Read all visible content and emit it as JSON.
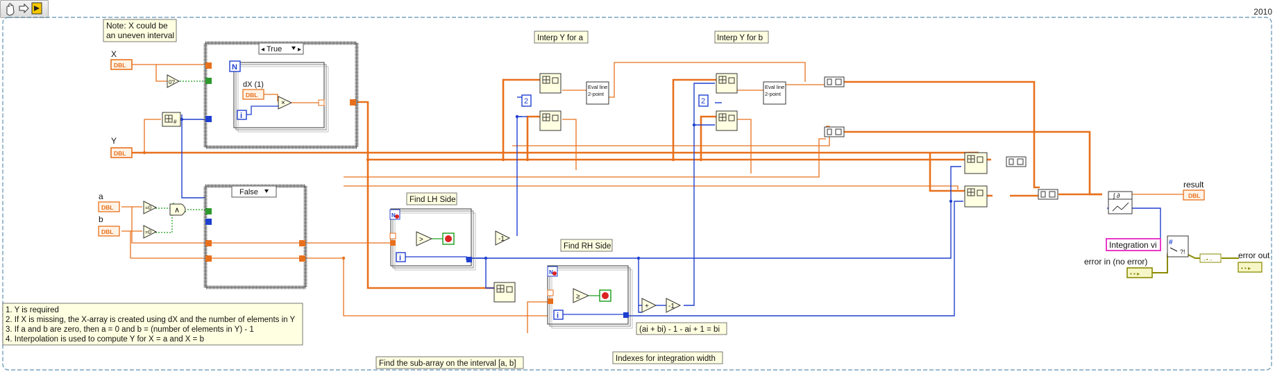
{
  "toolbar": {
    "tools": [
      "hand-tool-icon",
      "run-arrow-icon",
      "highlight-execution-icon"
    ]
  },
  "version_label": "2010",
  "colors": {
    "orange_wire": "#e8701c",
    "blue_wire": "#1f3fcf",
    "green_wire": "#169a16",
    "frame_dash": "#5c8fb0",
    "note_bg": "#ffffe1",
    "pink": "#e838c8"
  },
  "notes": {
    "note_x": [
      "Note:  X could be",
      "an uneven interval"
    ],
    "requirements": [
      "1.  Y is required",
      "2.  If X is missing, the X-array is created using dX and the number of elements in Y",
      "3.  If a and b are zero, then a = 0 and b = (number of elements in Y) - 1",
      "4.  Interpolation is used to compute Y for X = a and X = b"
    ]
  },
  "labels": {
    "interp_a": "Interp Y for a",
    "interp_b": "Interp Y for b",
    "find_lh": "Find LH Side",
    "find_rh": "Find RH Side",
    "sub_array": "Find the sub-array on the interval [a, b]",
    "indexes": "Indexes for integration width",
    "formula": "(ai + bi) - 1 - ai + 1 = bi",
    "dx": "dX (1)"
  },
  "controls": {
    "x": {
      "label": "X",
      "type": "DBL"
    },
    "y": {
      "label": "Y",
      "type": "DBL"
    },
    "a": {
      "label": "a",
      "type": "DBL"
    },
    "b": {
      "label": "b",
      "type": "DBL"
    },
    "dx": {
      "type": "DBL"
    },
    "error_in": {
      "label": "error in (no error)"
    }
  },
  "indicators": {
    "result": {
      "label": "result",
      "type": "DBL"
    },
    "error_out": {
      "label": "error out"
    }
  },
  "case_true": "True",
  "case_false": "False",
  "terminals": {
    "n": "N",
    "i": "i",
    "q": "?"
  },
  "eval_line": [
    "Eval line",
    "2-point"
  ],
  "constant_two": "2",
  "integration_vi": "Integration vi",
  "integ_label": "∫ ∂"
}
